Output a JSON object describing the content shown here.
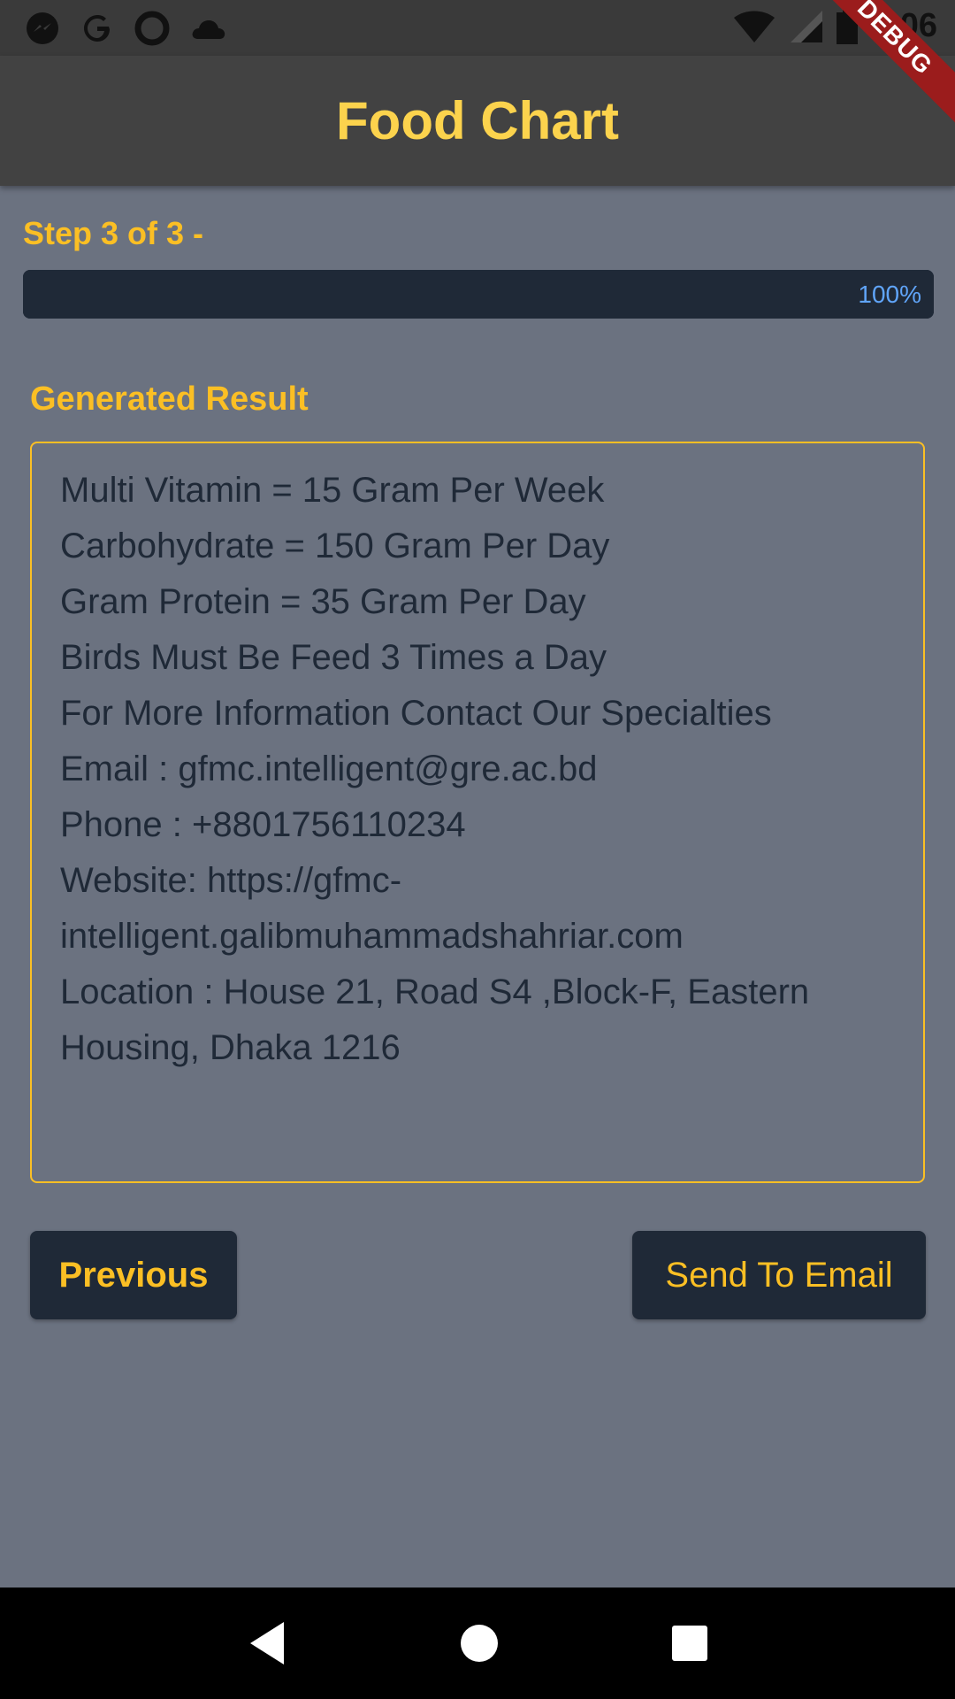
{
  "status_bar": {
    "time": "7:06",
    "left_icons": [
      "messenger-icon",
      "google-icon",
      "circle-app-icon",
      "cloud-icon"
    ],
    "right_icons": [
      "wifi-icon",
      "signal-icon",
      "battery-icon"
    ]
  },
  "debug_banner": "DEBUG",
  "app_bar": {
    "title": "Food Chart"
  },
  "stepper": {
    "label": "Step 3 of 3 -",
    "progress_percent": 100,
    "progress_text": "100%"
  },
  "result": {
    "heading": "Generated Result",
    "lines": [
      "Multi Vitamin = 15 Gram Per Week",
      "Carbohydrate = 150 Gram Per Day",
      "Gram Protein = 35 Gram Per Day",
      "Birds Must Be Feed 3 Times a Day",
      "For More Information Contact Our Specialties",
      "Email : gfmc.intelligent@gre.ac.bd",
      "Phone : +8801756110234",
      "Website: https://gfmc-",
      "intelligent.galibmuhammadshahriar.com",
      "Location : House 21, Road S4 ,Block-F, Eastern",
      "Housing, Dhaka 1216"
    ]
  },
  "buttons": {
    "previous": "Previous",
    "send_email": "Send To Email"
  },
  "nav_bar": {
    "icons": [
      "back-icon",
      "home-icon",
      "recents-icon"
    ]
  },
  "colors": {
    "accent": "#fbbf24",
    "background": "#6b7280",
    "dark": "#1f2937",
    "app_bar": "#424242"
  }
}
